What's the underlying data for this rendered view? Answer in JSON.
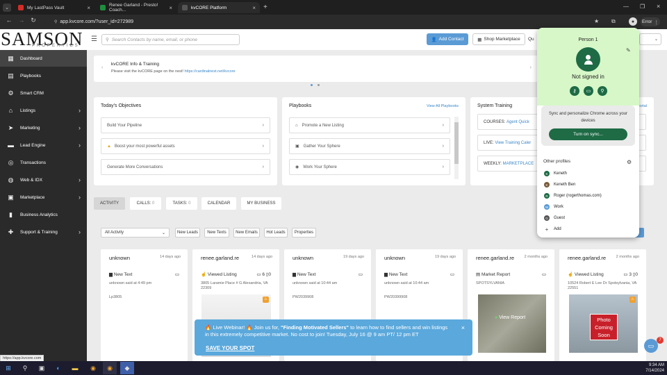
{
  "browser": {
    "tabs": [
      {
        "title": "My LastPass Vault",
        "color": "#d32d27"
      },
      {
        "title": "Renee Garland - Presto! Coach...",
        "color": "#1e8e3e"
      },
      {
        "title": "kvCORE Platform",
        "color": "#333333"
      }
    ],
    "url": "app.kvcore.com/?user_id=272989",
    "error_chip": "Error",
    "status_url": "https://app.kvcore.com"
  },
  "header": {
    "logo": "SAMSON",
    "logo_sub": "PROPERTIES",
    "search_placeholder": "Search Contacts by name, email, or phone",
    "add_contact": "Add Contact",
    "shop_marketplace": "Shop Marketplace",
    "quick": "Qu"
  },
  "sidebar": {
    "items": [
      {
        "label": "Dashboard",
        "icon": "dashboard-icon",
        "glyph": "▦",
        "chev": false
      },
      {
        "label": "Playbooks",
        "icon": "playbook-icon",
        "glyph": "▤",
        "chev": false
      },
      {
        "label": "Smart CRM",
        "icon": "crm-icon",
        "glyph": "⚙",
        "chev": false
      },
      {
        "label": "Listings",
        "icon": "home-icon",
        "glyph": "⌂",
        "chev": true
      },
      {
        "label": "Marketing",
        "icon": "send-icon",
        "glyph": "➤",
        "chev": true
      },
      {
        "label": "Lead Engine",
        "icon": "lead-icon",
        "glyph": "▬",
        "chev": true
      },
      {
        "label": "Transactions",
        "icon": "transactions-icon",
        "glyph": "◎",
        "chev": false
      },
      {
        "label": "Web & IDX",
        "icon": "web-icon",
        "glyph": "◍",
        "chev": true
      },
      {
        "label": "Marketplace",
        "icon": "marketplace-icon",
        "glyph": "▣",
        "chev": true
      },
      {
        "label": "Business Analytics",
        "icon": "analytics-icon",
        "glyph": "▮",
        "chev": false
      },
      {
        "label": "Support & Training",
        "icon": "support-icon",
        "glyph": "✚",
        "chev": true
      }
    ]
  },
  "info": {
    "title": "kvCORE Info & Training",
    "text": "Please visit the kvCORE page on the nest!",
    "link": "https://cardinalnest.net/kvcore"
  },
  "objectives": {
    "title": "Today's Objectives",
    "items": [
      "Build Your Pipeline",
      "Boost your most powerful assets",
      "Generate More Conversations"
    ]
  },
  "playbooks": {
    "title": "Playbooks",
    "view_all": "View All Playbooks",
    "items": [
      "Promote a New Listing",
      "Gather Your Sphere",
      "Work Your Sphere"
    ]
  },
  "training": {
    "title": "System Training",
    "portal": "ortal",
    "rows": [
      {
        "label": "COURSES:",
        "link": "Agent Quick"
      },
      {
        "label": "LIVE:",
        "link": "View Training Caler"
      },
      {
        "label": "WEEKLY:",
        "link": "MARKETPLACE"
      }
    ]
  },
  "activity_tabs": [
    {
      "label": "ACTIVITY",
      "count": ""
    },
    {
      "label": "CALLS:",
      "count": "0"
    },
    {
      "label": "TASKS:",
      "count": "0"
    },
    {
      "label": "CALENDAR",
      "count": ""
    },
    {
      "label": "MY BUSINESS",
      "count": ""
    }
  ],
  "filters": {
    "select": "All Activity",
    "buttons": [
      "New Leads",
      "New Texts",
      "New Emails",
      "Hot Leads",
      "Properties"
    ]
  },
  "activity_cards": [
    {
      "name": "unknown",
      "ago": "14 days ago",
      "type": "New Text",
      "desc": "unknown said at 4:49 pm",
      "extra": "Lp3805",
      "counts": ""
    },
    {
      "name": "renee.garland.re",
      "ago": "14 days ago",
      "type": "Viewed Listing",
      "desc": "3805 Laramie Place # G Alexandria, VA 22309",
      "extra": "",
      "counts": "6 ▯0"
    },
    {
      "name": "unknown",
      "ago": "19 days ago",
      "type": "New Text",
      "desc": "unknown said at 10:44 am",
      "extra": "PW2039908",
      "counts": ""
    },
    {
      "name": "unknown",
      "ago": "19 days ago",
      "type": "New Text",
      "desc": "unknown said at 10:44 am",
      "extra": "PW20399908",
      "counts": ""
    },
    {
      "name": "renee.garland.re",
      "ago": "2 months ago",
      "type": "Market Report",
      "desc": "SPOTSYLVANIA",
      "extra": "",
      "counts": ""
    },
    {
      "name": "renee.garland.re",
      "ago": "2 months ago",
      "type": "Viewed Listing",
      "desc": "10524 Robert E Lee Dr Spotsylvania, VA 22551",
      "extra": "",
      "counts": "3 ▯0"
    }
  ],
  "view_report": "View Report",
  "photo_badge": "Photo Coming Soon",
  "webinar": {
    "text_pre": "Live Webinar! ",
    "text_mid": " Join us for, ",
    "highlight": "\"Finding Motivated Sellers\"",
    "text_post": " to learn how to find sellers and win listings in this extremely competitive market. No cost to join! Tuesday, July 16 @ 9 am PT/ 12 pm ET",
    "cta": "SAVE YOUR SPOT"
  },
  "profile": {
    "name": "Person 1",
    "status": "Not signed in",
    "sync_text": "Sync and personalize Chrome across your devices",
    "sync_btn": "Turn on sync...",
    "other_profiles": "Other profiles",
    "profiles": [
      {
        "label": "Keneth",
        "initial": "K",
        "color": "#1e6b45"
      },
      {
        "label": "Keneth Ben",
        "initial": "K",
        "color": "#7a5b3a"
      },
      {
        "label": "Roger (rogerthomas.com)",
        "initial": "R",
        "color": "#1e6b45"
      },
      {
        "label": "Work",
        "initial": "W",
        "color": "#5b9bd5"
      },
      {
        "label": "Guest",
        "initial": "G",
        "color": "#555555"
      },
      {
        "label": "Add",
        "initial": "+",
        "color": "#ffffff"
      }
    ]
  },
  "taskbar": {
    "time": "9:34 AM",
    "date": "7/14/2024",
    "chat_badge": "7"
  }
}
